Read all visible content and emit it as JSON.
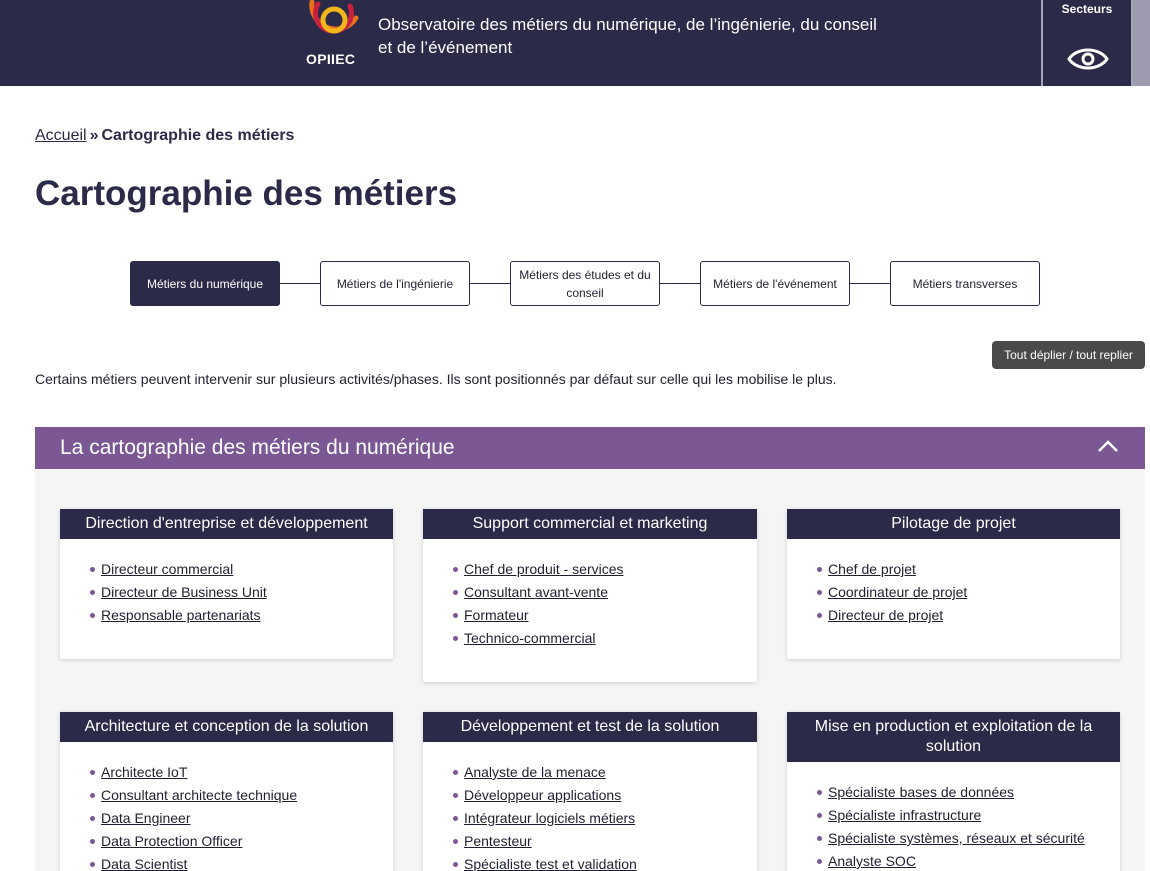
{
  "header": {
    "logo_text": "OPIIEC",
    "site_title": "Observatoire des métiers du numérique, de l’ingénierie, du conseil et de l’événement",
    "sectors_label": "Secteurs"
  },
  "breadcrumb": {
    "home": "Accueil",
    "separator": "»",
    "current": "Cartographie des métiers"
  },
  "page_title": "Cartographie des métiers",
  "tabs": [
    {
      "label": "Métiers du numérique",
      "active": true
    },
    {
      "label": "Métiers de l'ingénierie",
      "active": false
    },
    {
      "label": "Métiers des études et du conseil",
      "active": false
    },
    {
      "label": "Métiers de l'événement",
      "active": false
    },
    {
      "label": "Métiers transverses",
      "active": false
    }
  ],
  "toggle_all_label": "Tout déplier / tout replier",
  "intro_text": "Certains métiers peuvent intervenir sur plusieurs activités/phases. Ils sont positionnés par défaut sur celle qui les mobilise le plus.",
  "accordion": {
    "title": "La cartographie des métiers du numérique"
  },
  "cards": [
    {
      "title": "Direction d'entreprise et développement",
      "items": [
        "Directeur commercial",
        "Directeur de Business Unit",
        "Responsable partenariats"
      ]
    },
    {
      "title": "Support commercial et marketing",
      "items": [
        "Chef de produit - services",
        "Consultant avant-vente",
        "Formateur",
        "Technico-commercial"
      ]
    },
    {
      "title": "Pilotage de projet",
      "items": [
        "Chef de projet",
        "Coordinateur de projet",
        "Directeur de projet"
      ]
    },
    {
      "title": "Architecture et conception de la solution",
      "items": [
        "Architecte IoT",
        "Consultant architecte technique",
        "Data Engineer",
        "Data Protection Officer",
        "Data Scientist"
      ]
    },
    {
      "title": "Développement et test de la solution",
      "items": [
        "Analyste de la menace",
        "Développeur applications",
        "Intégrateur logiciels métiers",
        "Pentesteur",
        "Spécialiste test et validation"
      ]
    },
    {
      "title": "Mise en production et exploitation de la solution",
      "items": [
        "Spécialiste bases de données",
        "Spécialiste infrastructure",
        "Spécialiste systèmes, réseaux et sécurité",
        "Analyste SOC"
      ]
    }
  ],
  "colors": {
    "navy": "#2b2a48",
    "purple": "#7b5794",
    "logo_orange": "#e8711f",
    "logo_red": "#c8213f",
    "logo_yellow": "#f2b51b"
  }
}
